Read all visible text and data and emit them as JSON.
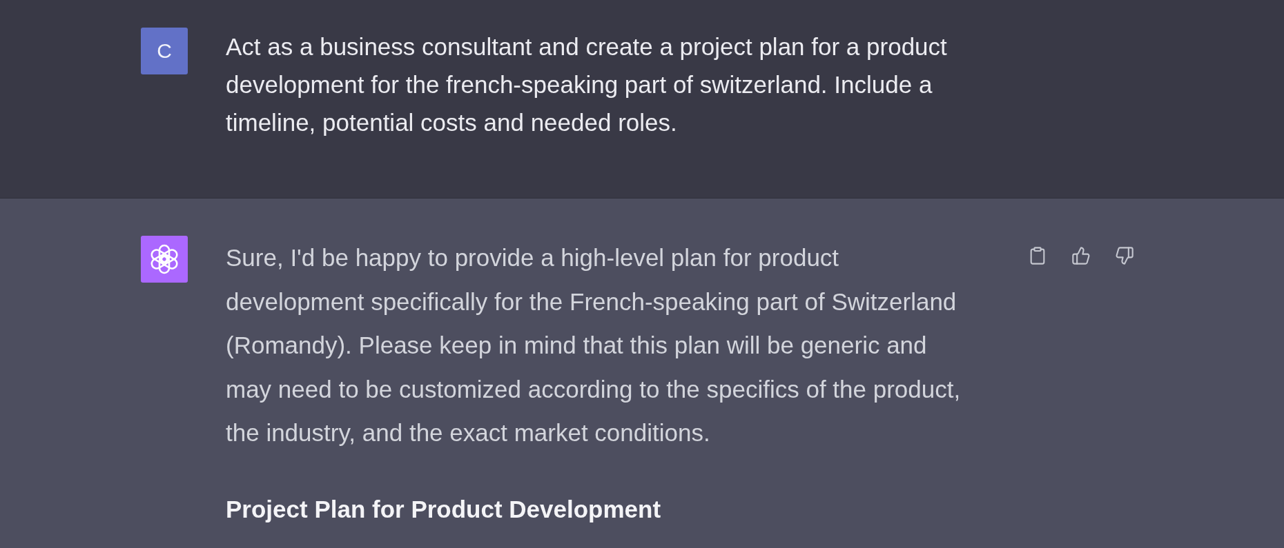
{
  "messages": [
    {
      "kind": "user",
      "avatar": "C",
      "blocks": [
        {
          "kind": "paragraph",
          "text": "Act as a business consultant and create a project plan for a product development for the french-speaking part of switzerland. Include a timeline, potential costs and needed roles."
        }
      ]
    },
    {
      "kind": "assistant",
      "blocks": [
        {
          "kind": "paragraph",
          "text": "Sure, I'd be happy to provide a high-level plan for product development specifically for the French-speaking part of Switzerland (Romandy). Please keep in mind that this plan will be generic and may need to be customized according to the specifics of the product, the industry, and the exact market conditions."
        },
        {
          "kind": "heading",
          "text": "Project Plan for Product Development"
        }
      ],
      "actions": [
        {
          "kind": "copy"
        },
        {
          "kind": "thumbs_up"
        },
        {
          "kind": "thumbs_down"
        }
      ]
    }
  ]
}
